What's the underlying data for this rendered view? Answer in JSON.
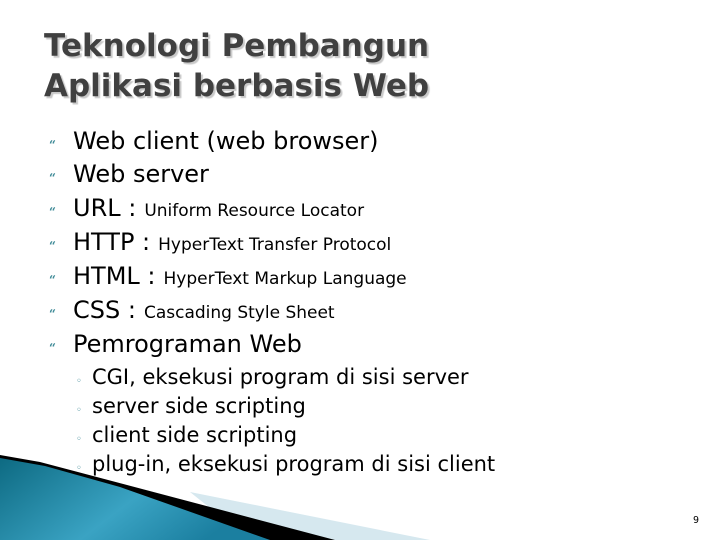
{
  "slide": {
    "title_lines": [
      "Teknologi Pembangun",
      "Aplikasi berbasis Web"
    ],
    "bullet_icon": "quote-bullet-icon",
    "sub_bullet_icon": "circle-bullet-icon",
    "bullets": [
      {
        "main": "Web client (web browser)",
        "sub": ""
      },
      {
        "main": "Web server",
        "sub": ""
      },
      {
        "main": "URL :",
        "sub": "Uniform Resource Locator"
      },
      {
        "main": "HTTP :",
        "sub": "HyperText Transfer Protocol"
      },
      {
        "main": "HTML :",
        "sub": "HyperText Markup Language"
      },
      {
        "main": "CSS :",
        "sub": "Cascading Style Sheet"
      },
      {
        "main": "Pemrograman Web",
        "sub": ""
      }
    ],
    "sub_bullets": [
      "CGI, eksekusi program di sisi server",
      "server side scripting",
      "client side scripting",
      "plug-in, eksekusi program di sisi client"
    ],
    "page_number": "9"
  },
  "glyphs": {
    "bullet": "“",
    "sub_bullet": "◦"
  },
  "colors": {
    "title": "#404040",
    "bullet": "#3e8a97",
    "swoosh_teal": "#1e7f99",
    "swoosh_light": "#d6e8ef",
    "swoosh_dark": "#000000"
  }
}
